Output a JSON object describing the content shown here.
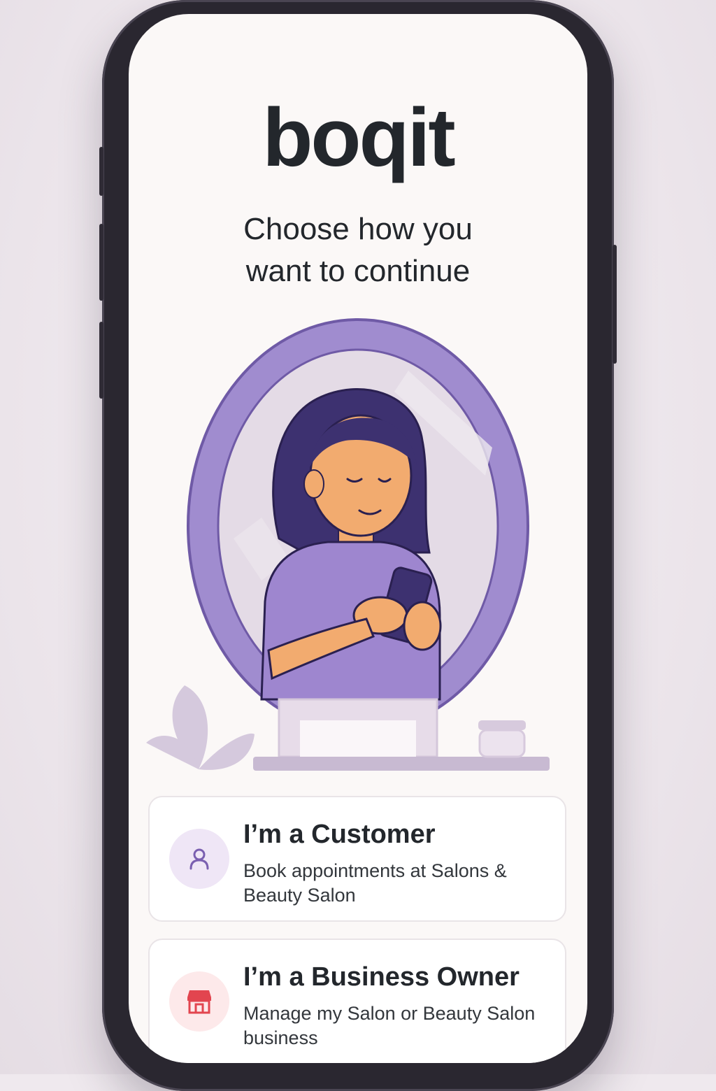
{
  "app": {
    "logo": "boqit"
  },
  "heading": {
    "line1": "Choose how you",
    "line2": "want to continue"
  },
  "options": [
    {
      "title": "I’m a Customer",
      "description": "Book appointments at Salons & Beauty Salon",
      "icon": "person-icon",
      "icon_color": "#7a5fb0",
      "icon_bg": "#efe6f6"
    },
    {
      "title": "I’m a Business Owner",
      "description": "Manage my Salon or Beauty Salon business",
      "icon": "storefront-icon",
      "icon_color": "#e2454f",
      "icon_bg": "#fde9ea"
    }
  ],
  "colors": {
    "accent_purple": "#9a86c9",
    "mirror_frame": "#a08ccf",
    "text_dark": "#23272c",
    "screen_bg": "#fbf8f7"
  }
}
